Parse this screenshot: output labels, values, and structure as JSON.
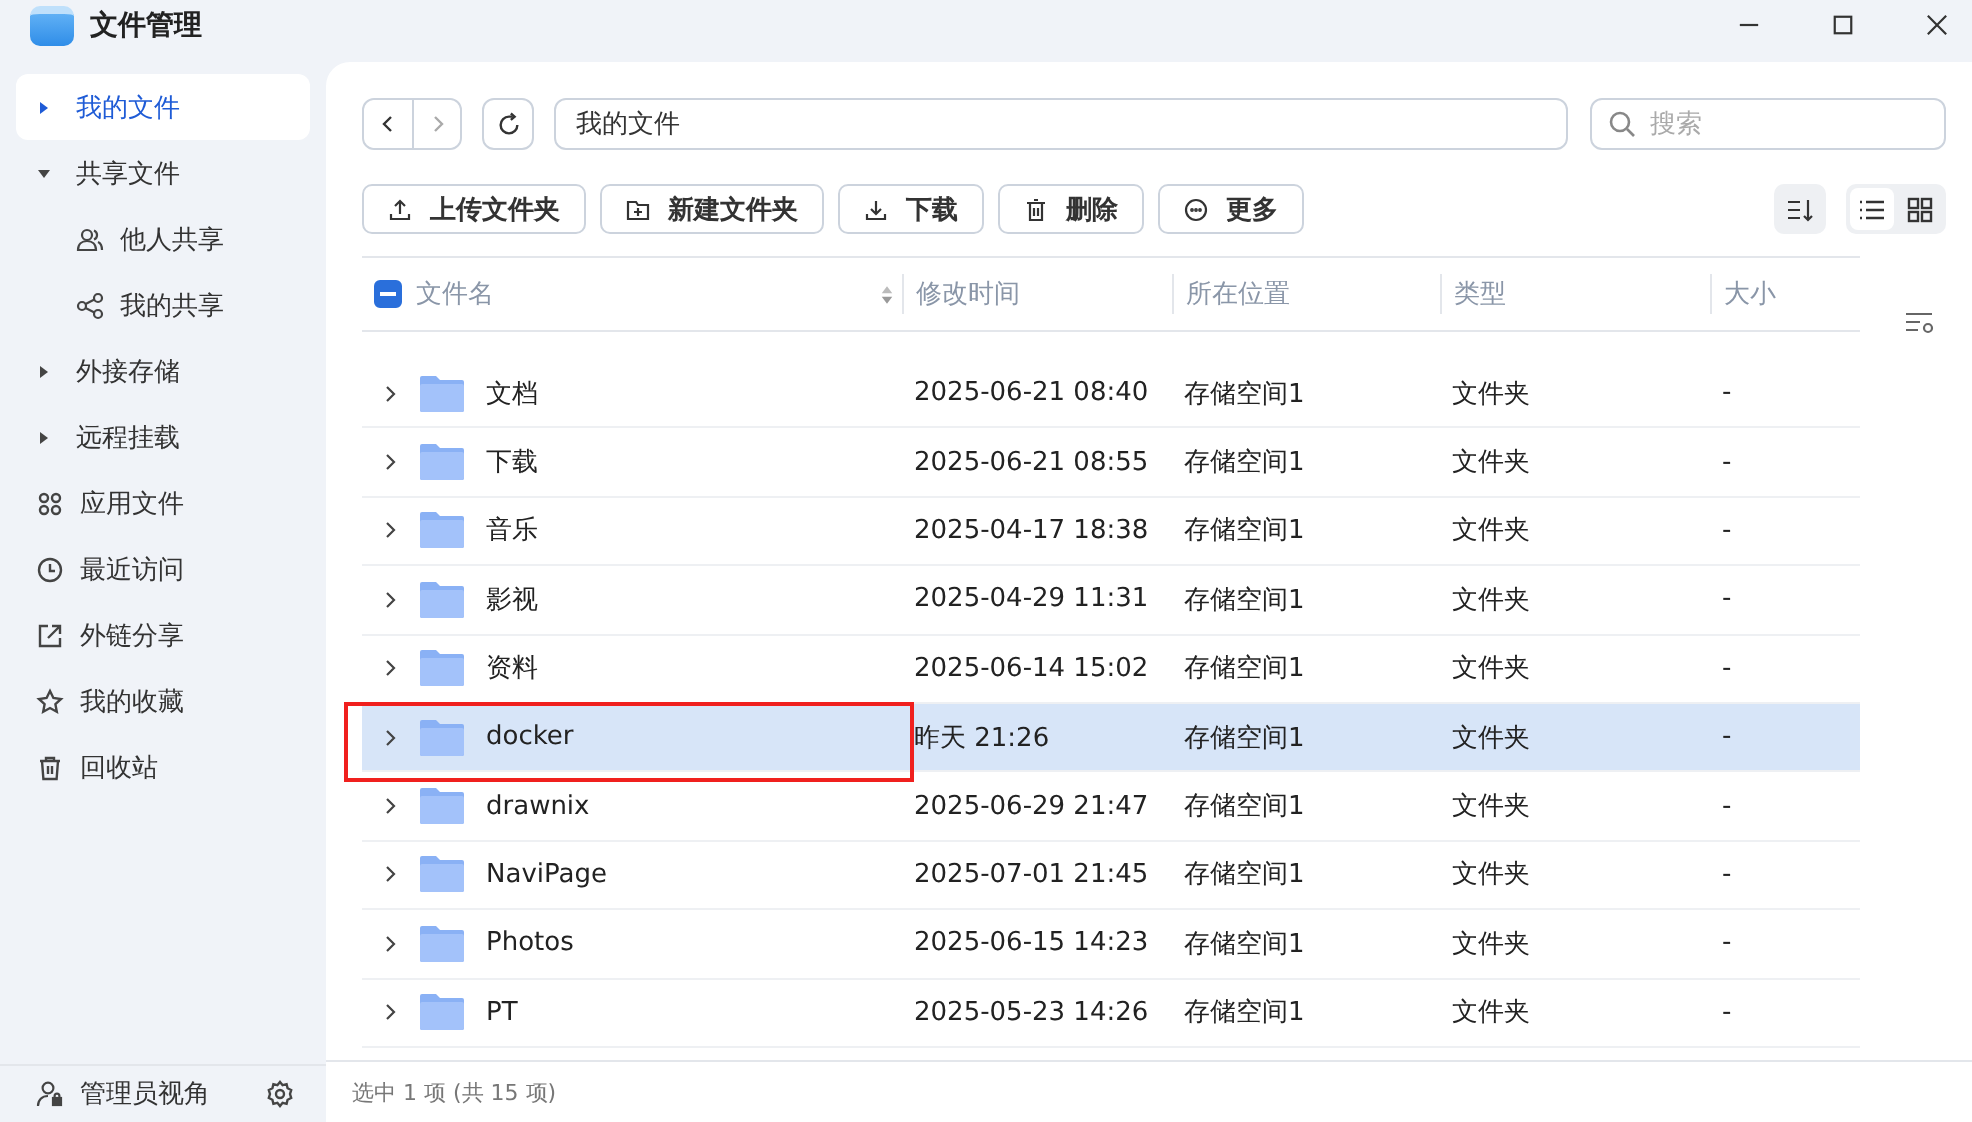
{
  "window": {
    "title": "文件管理"
  },
  "sidebar": {
    "items": [
      {
        "label": "我的文件",
        "kind": "tree",
        "expanded": false,
        "selected": true
      },
      {
        "label": "共享文件",
        "kind": "tree",
        "expanded": true,
        "selected": false,
        "children": [
          {
            "label": "他人共享",
            "selected": false
          },
          {
            "label": "我的共享",
            "selected": false
          }
        ]
      },
      {
        "label": "外接存储",
        "kind": "tree",
        "expanded": false,
        "selected": false
      },
      {
        "label": "远程挂载",
        "kind": "tree",
        "expanded": false,
        "selected": false
      },
      {
        "label": "应用文件",
        "kind": "link",
        "selected": false
      },
      {
        "label": "最近访问",
        "kind": "link",
        "selected": false
      },
      {
        "label": "外链分享",
        "kind": "link",
        "selected": false
      },
      {
        "label": "我的收藏",
        "kind": "link",
        "selected": false
      },
      {
        "label": "回收站",
        "kind": "link",
        "selected": false
      }
    ],
    "footer": {
      "label": "管理员视角"
    }
  },
  "path": {
    "value": "我的文件"
  },
  "search": {
    "placeholder": "搜索"
  },
  "actions": [
    "上传文件夹",
    "新建文件夹",
    "下载",
    "删除",
    "更多"
  ],
  "view": {
    "list_selected": true
  },
  "table": {
    "columns": [
      "文件名",
      "修改时间",
      "所在位置",
      "类型",
      "大小"
    ],
    "select_all": {
      "indeterminate": true
    },
    "rows": [
      {
        "name": "文档",
        "modified": "2025-06-21 08:40",
        "location": "存储空间1",
        "type": "文件夹",
        "size": "-",
        "selected": false,
        "highlighted": false
      },
      {
        "name": "下载",
        "modified": "2025-06-21 08:55",
        "location": "存储空间1",
        "type": "文件夹",
        "size": "-",
        "selected": false,
        "highlighted": false
      },
      {
        "name": "音乐",
        "modified": "2025-04-17 18:38",
        "location": "存储空间1",
        "type": "文件夹",
        "size": "-",
        "selected": false,
        "highlighted": false
      },
      {
        "name": "影视",
        "modified": "2025-04-29 11:31",
        "location": "存储空间1",
        "type": "文件夹",
        "size": "-",
        "selected": false,
        "highlighted": false
      },
      {
        "name": "资料",
        "modified": "2025-06-14 15:02",
        "location": "存储空间1",
        "type": "文件夹",
        "size": "-",
        "selected": false,
        "highlighted": false
      },
      {
        "name": "docker",
        "modified": "昨天 21:26",
        "location": "存储空间1",
        "type": "文件夹",
        "size": "-",
        "selected": true,
        "highlighted": true
      },
      {
        "name": "drawnix",
        "modified": "2025-06-29 21:47",
        "location": "存储空间1",
        "type": "文件夹",
        "size": "-",
        "selected": false,
        "highlighted": false
      },
      {
        "name": "NaviPage",
        "modified": "2025-07-01 21:45",
        "location": "存储空间1",
        "type": "文件夹",
        "size": "-",
        "selected": false,
        "highlighted": false
      },
      {
        "name": "Photos",
        "modified": "2025-06-15 14:23",
        "location": "存储空间1",
        "type": "文件夹",
        "size": "-",
        "selected": false,
        "highlighted": false
      },
      {
        "name": "PT",
        "modified": "2025-05-23 14:26",
        "location": "存储空间1",
        "type": "文件夹",
        "size": "-",
        "selected": false,
        "highlighted": false
      }
    ]
  },
  "status_bar": "选中 1 项 (共 15 项)"
}
